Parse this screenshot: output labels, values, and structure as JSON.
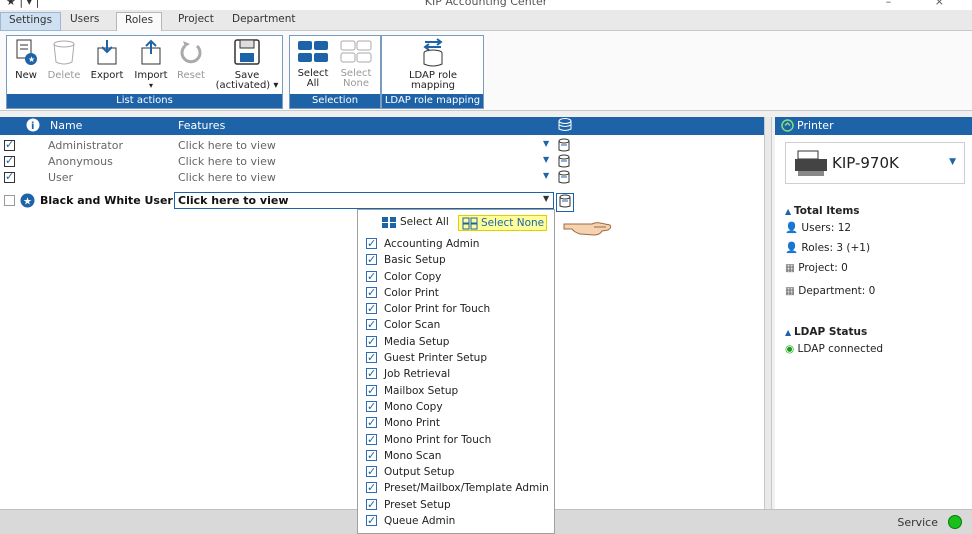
{
  "window": {
    "title": "KIP Accounting Center",
    "controls": "–  ×"
  },
  "tabs": [
    {
      "label": "Settings"
    },
    {
      "label": "Users"
    },
    {
      "label": "Roles"
    },
    {
      "label": "Project"
    },
    {
      "label": "Department"
    }
  ],
  "ribbon": {
    "list_actions": {
      "label": "List actions",
      "new": "New",
      "delete": "Delete",
      "export": "Export",
      "import": "Import",
      "reset": "Reset",
      "save": "Save",
      "save_sub": "(activated) ▾"
    },
    "selection": {
      "label": "Selection",
      "select_all_1": "Select",
      "select_all_2": "All",
      "select_none_1": "Select",
      "select_none_2": "None"
    },
    "ldap": {
      "label": "LDAP role mapping",
      "btn_1": "LDAP role",
      "btn_2": "mapping"
    }
  },
  "list": {
    "col_name": "Name",
    "col_features": "Features",
    "rows": [
      {
        "name": "Administrator",
        "features": "Click here to view",
        "checked": true
      },
      {
        "name": "Anonymous",
        "features": "Click here to view",
        "checked": true
      },
      {
        "name": "User",
        "features": "Click here to view",
        "checked": true
      },
      {
        "name": "Black and White User",
        "features": "Click here to view",
        "checked": false
      }
    ]
  },
  "popup": {
    "select_all": "Select All",
    "select_none": "Select None",
    "items": [
      "Accounting Admin",
      "Basic Setup",
      "Color Copy",
      "Color Print",
      "Color Print for Touch",
      "Color Scan",
      "Media Setup",
      "Guest Printer Setup",
      "Job Retrieval",
      "Mailbox Setup",
      "Mono Copy",
      "Mono Print",
      "Mono Print for Touch",
      "Mono Scan",
      "Output Setup",
      "Preset/Mailbox/Template Admin",
      "Preset Setup",
      "Queue Admin"
    ]
  },
  "right": {
    "header": "Printer",
    "printer_name": "KIP-970K",
    "total_items": "Total Items",
    "users": "Users: 12",
    "roles": "Roles: 3 (+1)",
    "project": "Project: 0",
    "department": "Department: 0",
    "ldap_status": "LDAP Status",
    "ldap_connected": "LDAP connected"
  },
  "status": {
    "service": "Service",
    "service_color": "#19c01a"
  },
  "colors": {
    "accent": "#1e63a8",
    "highlight": "#ffff99"
  }
}
